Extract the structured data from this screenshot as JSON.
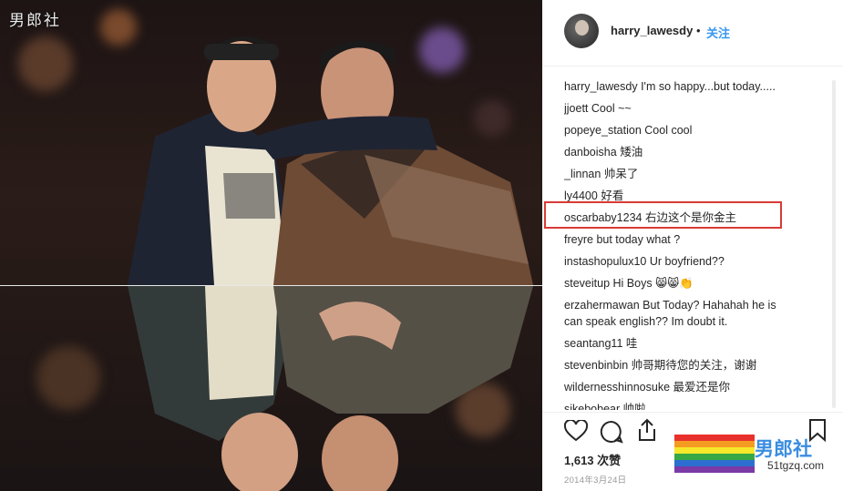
{
  "photo": {
    "watermark": "男郎社"
  },
  "post": {
    "username": "harry_lawesdy",
    "separator": "•",
    "follow_label": "关注"
  },
  "comments": [
    {
      "user": "harry_lawesdy",
      "text": "I'm so happy...but today....."
    },
    {
      "user": "jjoett",
      "text": "Cool ~~"
    },
    {
      "user": "popeye_station",
      "text": "Cool cool"
    },
    {
      "user": "danboisha",
      "text": "矮油"
    },
    {
      "user": "_linnan",
      "text": "帅呆了"
    },
    {
      "user": "ly4400",
      "text": "好看"
    },
    {
      "user": "oscarbaby1234",
      "text": "右边这个是你金主"
    },
    {
      "user": "freyre",
      "text": "but today what ?"
    },
    {
      "user": "instashopulux10",
      "text": "Ur boyfriend??"
    },
    {
      "user": "steveitup",
      "text": "Hi Boys 😸😸👏"
    },
    {
      "user": "erzahermawan",
      "text": "But Today? Hahahah he is"
    },
    {
      "user": "",
      "text": "can speak english?? Im doubt it."
    },
    {
      "user": "seantang11",
      "text": "哇"
    },
    {
      "user": "stevenbinbin",
      "text": "帅哥期待您的关注，谢谢"
    },
    {
      "user": "wildernesshinnosuke",
      "text": "最爱还是你"
    },
    {
      "user": "sikebobear",
      "text": "帅啦"
    }
  ],
  "actions": {
    "like_icon": "heart-icon",
    "comment_icon": "comment-icon",
    "share_icon": "share-icon",
    "save_icon": "bookmark-icon"
  },
  "likes": "1,613 次赞",
  "date": "2014年3月24日",
  "overlay_logo": {
    "name": "男郎社",
    "url": "51tgzq.com",
    "rainbow_colors": [
      "#e8312c",
      "#f39c21",
      "#f6e82a",
      "#36a845",
      "#2c6fd1",
      "#7b3aa6"
    ]
  },
  "colors": {
    "follow": "#3897f0",
    "highlight": "#d93a37"
  }
}
